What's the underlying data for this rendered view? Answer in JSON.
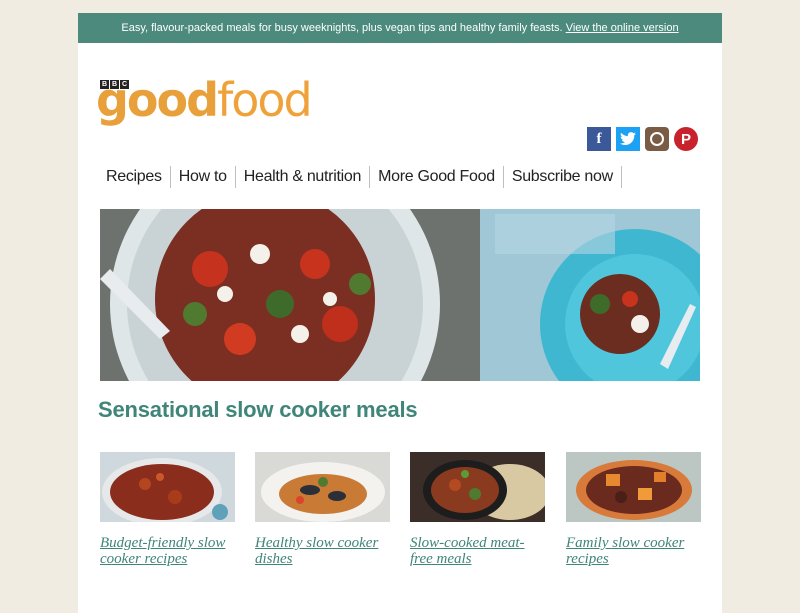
{
  "banner": {
    "text": "Easy, flavour-packed meals for busy weeknights, plus vegan tips and healthy family feasts.",
    "link": "View the online version"
  },
  "logo": {
    "bbc": [
      "B",
      "B",
      "C"
    ],
    "word_bold": "good",
    "word_light": "food"
  },
  "social": {
    "facebook": "f",
    "twitter": "t",
    "pinterest": "P"
  },
  "nav": [
    "Recipes",
    "How to",
    "Health & nutrition",
    "More Good Food",
    "Subscribe now"
  ],
  "main": {
    "heading": "Sensational slow cooker meals",
    "cards": [
      {
        "label": "Budget-friendly slow cooker recipes"
      },
      {
        "label": "Healthy slow cooker dishes"
      },
      {
        "label": "Slow-cooked meat-free meals"
      },
      {
        "label": "Family slow cooker recipes"
      }
    ]
  },
  "colors": {
    "banner": "#4c8a7d",
    "accent": "#3f8579",
    "logo": "#f0a23a",
    "page_bg": "#f0ece2"
  }
}
